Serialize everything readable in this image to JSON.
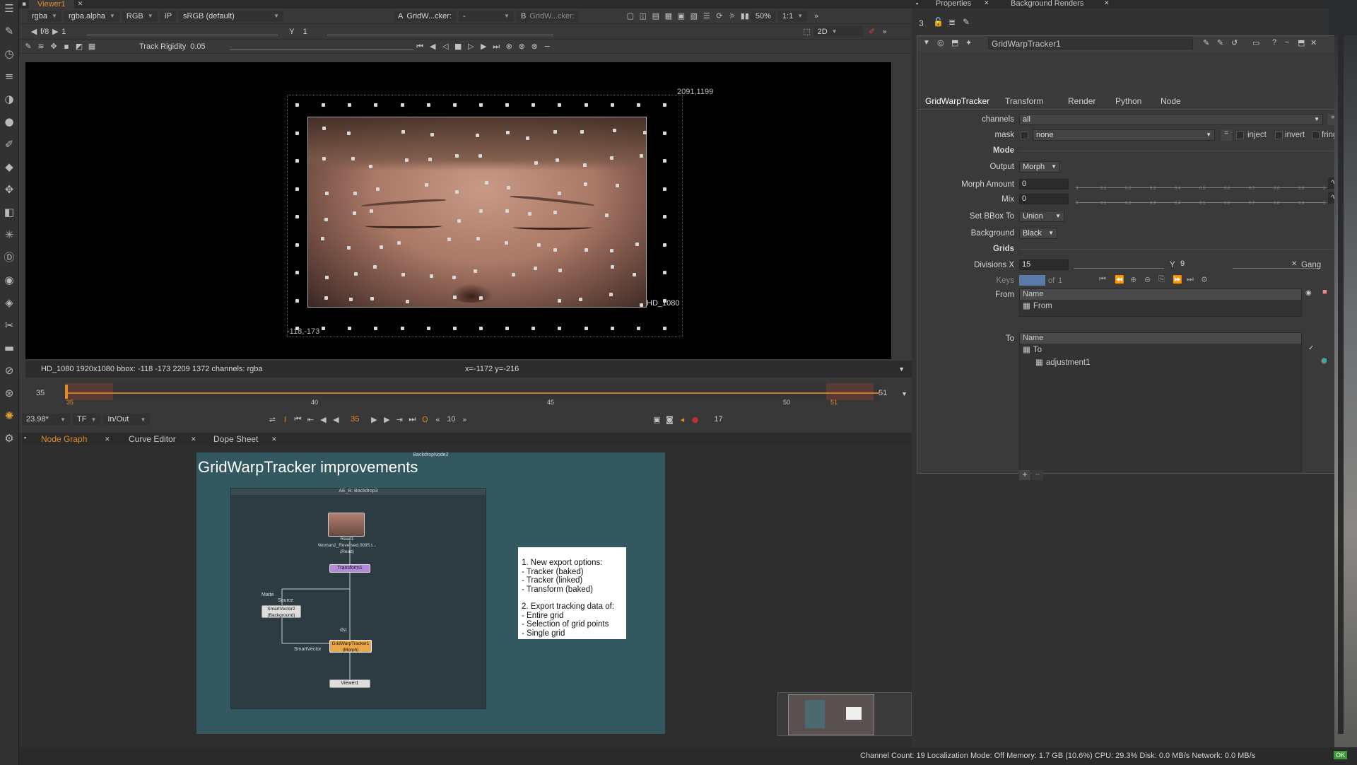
{
  "viewer": {
    "tab_label": "Viewer1",
    "channel_dd": "rgba",
    "alpha_dd": "rgba.alpha",
    "color_dd": "RGB",
    "ip_label": "IP",
    "lut_dd": "sRGB (default)",
    "input_a_label": "A",
    "input_a_dd": "GridW...cker:",
    "input_a_op": "-",
    "input_b_label": "B",
    "input_b_dd": "GridW...cker:",
    "zoom": "50%",
    "ratio": "1:1",
    "frame_label": "f/8",
    "frame_value": "1",
    "y_label": "Y",
    "y_value": "1",
    "view_mode": "2D",
    "track_rigidity_label": "Track Rigidity",
    "track_rigidity_value": "0.05",
    "format_top_right": "2091,1199",
    "format_name": "HD_1080",
    "format_bottom_left": "-118,-173",
    "info_text": "HD_1080 1920x1080  bbox: -118 -173 2209 1372 channels: rgba",
    "coords_text": "x=-1172 y=-216"
  },
  "timeline": {
    "start_frame": "35",
    "end_frame": "51",
    "ticks": [
      "35",
      "40",
      "45",
      "50",
      "51"
    ],
    "current_frame": "35",
    "fps": "23.98*",
    "tf_label": "TF",
    "range_mode": "In/Out",
    "step": "10",
    "playback_end": "17"
  },
  "node_graph": {
    "tabs": [
      "Node Graph",
      "Curve Editor",
      "Dope Sheet"
    ],
    "backdrop_title": "GridWarpTracker improvements",
    "backdrop_label": "BackdropNode2",
    "inner_backdrop_label": "AE_B: Backdrop3",
    "nodes": {
      "read": "Read1\nWoman2_Reversed.0095.t...\n(Read)",
      "transform": "Transform1",
      "smartvector": "SmartVector2\n(Background)",
      "gridwarp": "GridWarpTracker1\n(Morph)",
      "viewer": "Viewer1"
    },
    "pipe_labels": [
      "Matte",
      "Source",
      "SmartVector",
      "dst"
    ],
    "note_lines": [
      "1. New export options:",
      "- Tracker (baked)",
      "- Tracker (linked)",
      "- Transform (baked)",
      "",
      "2. Export tracking data of:",
      "- Entire grid",
      "- Selection of grid points",
      "- Single grid"
    ]
  },
  "properties": {
    "tabs_top": [
      "Properties",
      "Background Renders"
    ],
    "count": "3",
    "node_name": "GridWarpTracker1",
    "tabs": [
      "GridWarpTracker",
      "Transform",
      "Render",
      "Python",
      "Node"
    ],
    "channels_label": "channels",
    "channels_value": "all",
    "mask_label": "mask",
    "mask_value": "none",
    "inject_label": "inject",
    "invert_label": "invert",
    "fringe_label": "fringe",
    "mode_heading": "Mode",
    "output_label": "Output",
    "output_value": "Morph",
    "morph_amount_label": "Morph Amount",
    "morph_amount_value": "0",
    "mix_label": "Mix",
    "mix_value": "0",
    "slider_ticks": [
      "0",
      "0.1",
      "0.2",
      "0.3",
      "0.4",
      "0.5",
      "0.6",
      "0.7",
      "0.8",
      "0.9",
      "1"
    ],
    "bbox_label": "Set BBox To",
    "bbox_value": "Union",
    "background_label": "Background",
    "background_value": "Black",
    "grids_heading": "Grids",
    "divisions_label": "Divisions X",
    "divisions_x": "15",
    "divisions_y_label": "Y",
    "divisions_y": "9",
    "gang_label": "Gang",
    "keys_label": "Keys",
    "keys_of": "of",
    "keys_total": "1",
    "from_label": "From",
    "to_label": "To",
    "name_header": "Name",
    "from_item": "From",
    "to_item": "To",
    "to_child": "adjustment1"
  },
  "status": {
    "text": "Channel Count: 19  Localization Mode: Off  Memory: 1.7 GB (10.6%)  CPU: 29.3%  Disk: 0.0 MB/s  Network: 0.0 MB/s",
    "ok": "OK"
  },
  "colors": {
    "accent_orange": "#e08a2a",
    "backdrop_teal": "#34585f",
    "gridwarp_node": "#e8a84a",
    "transform_node": "#b48ad8"
  }
}
